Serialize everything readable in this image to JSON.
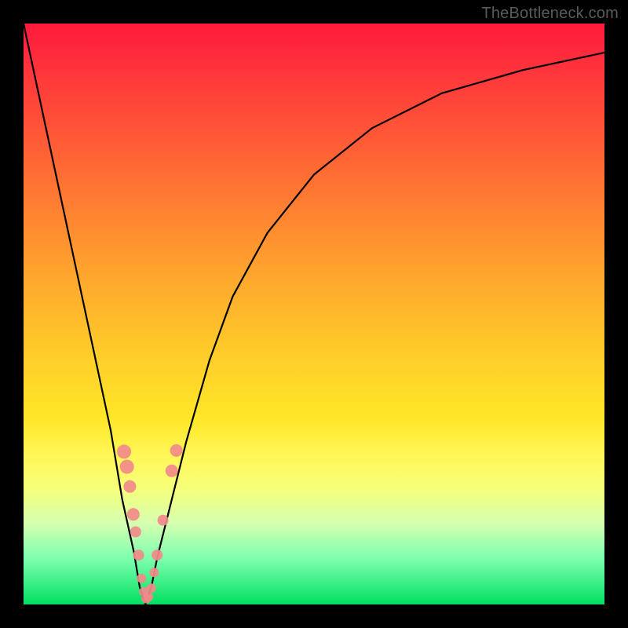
{
  "watermark": "TheBottleneck.com",
  "chart_data": {
    "type": "line",
    "title": "",
    "xlabel": "",
    "ylabel": "",
    "xlim": [
      0,
      100
    ],
    "ylim": [
      0,
      100
    ],
    "x_min_point": 21,
    "series": [
      {
        "name": "bottleneck-curve",
        "x": [
          0,
          3,
          6,
          9,
          12,
          15,
          17,
          19,
          20,
          21,
          22,
          23,
          25,
          28,
          32,
          36,
          42,
          50,
          60,
          72,
          86,
          100
        ],
        "y": [
          100,
          86,
          72,
          58,
          44,
          30,
          18,
          9,
          3,
          0,
          3,
          8,
          16,
          28,
          42,
          53,
          64,
          74,
          82,
          88,
          92,
          95
        ]
      }
    ],
    "highlight_points": {
      "name": "highlight-dots",
      "color": "#f28a8a",
      "points": [
        {
          "x": 17.3,
          "y": 26.3,
          "r": 9
        },
        {
          "x": 17.8,
          "y": 23.7,
          "r": 9
        },
        {
          "x": 18.3,
          "y": 20.3,
          "r": 8
        },
        {
          "x": 18.9,
          "y": 15.5,
          "r": 8
        },
        {
          "x": 19.3,
          "y": 12.5,
          "r": 7
        },
        {
          "x": 19.8,
          "y": 8.5,
          "r": 7
        },
        {
          "x": 20.3,
          "y": 4.5,
          "r": 6
        },
        {
          "x": 20.7,
          "y": 2.2,
          "r": 6
        },
        {
          "x": 21.1,
          "y": 1.0,
          "r": 6
        },
        {
          "x": 21.5,
          "y": 1.3,
          "r": 6
        },
        {
          "x": 22.0,
          "y": 2.8,
          "r": 6
        },
        {
          "x": 22.5,
          "y": 5.5,
          "r": 6
        },
        {
          "x": 23.0,
          "y": 8.5,
          "r": 7
        },
        {
          "x": 24.0,
          "y": 14.5,
          "r": 7
        },
        {
          "x": 25.5,
          "y": 23.0,
          "r": 8
        },
        {
          "x": 26.3,
          "y": 26.5,
          "r": 8
        }
      ]
    }
  }
}
